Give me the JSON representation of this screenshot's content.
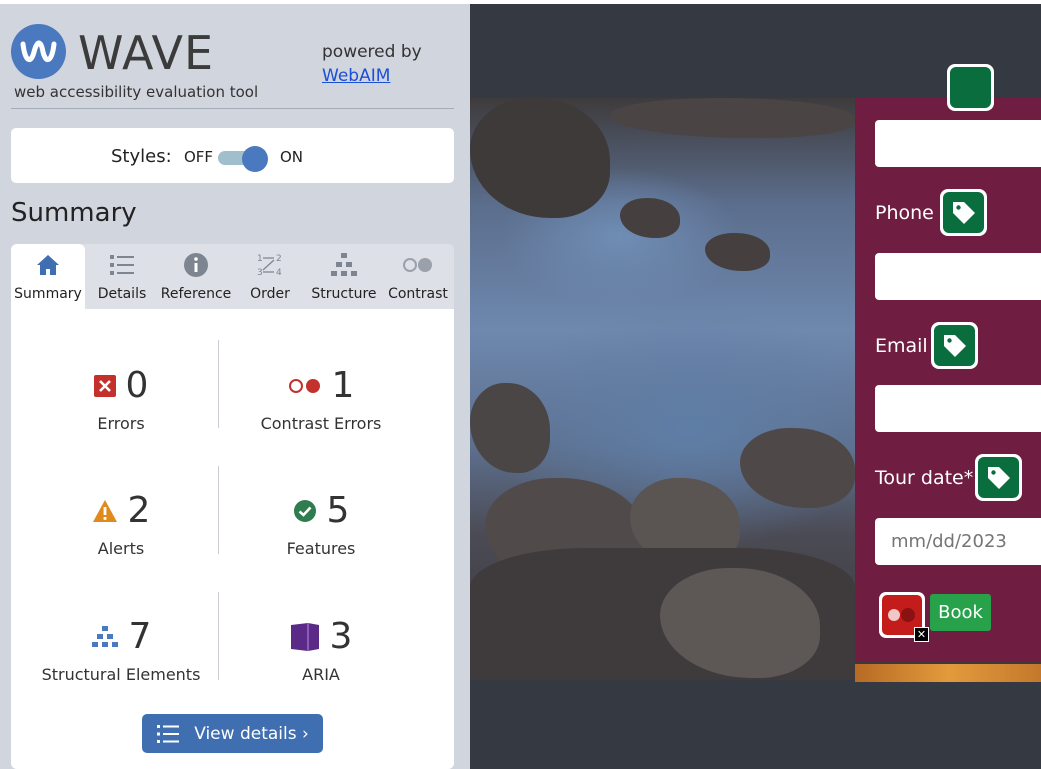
{
  "header": {
    "logo_text": "WAVE",
    "tagline": "web accessibility evaluation tool",
    "powered_by": "powered by",
    "powered_by_link": "WebAIM"
  },
  "styles_toggle": {
    "label": "Styles:",
    "off_label": "OFF",
    "on_label": "ON",
    "state": "ON"
  },
  "summary": {
    "heading": "Summary"
  },
  "tabs": [
    {
      "label": "Summary",
      "icon": "home-icon",
      "active": true
    },
    {
      "label": "Details",
      "icon": "list-icon",
      "active": false
    },
    {
      "label": "Reference",
      "icon": "info-icon",
      "active": false
    },
    {
      "label": "Order",
      "icon": "order-icon",
      "active": false
    },
    {
      "label": "Structure",
      "icon": "structure-icon",
      "active": false
    },
    {
      "label": "Contrast",
      "icon": "contrast-icon",
      "active": false
    }
  ],
  "stats": {
    "errors": {
      "count": "0",
      "label": "Errors",
      "color": "#c4302b"
    },
    "contrast_errors": {
      "count": "1",
      "label": "Contrast Errors",
      "color": "#c4302b"
    },
    "alerts": {
      "count": "2",
      "label": "Alerts",
      "color": "#e08a1e"
    },
    "features": {
      "count": "5",
      "label": "Features",
      "color": "#2f7d4f"
    },
    "structural": {
      "count": "7",
      "label": "Structural Elements",
      "color": "#4a79c0"
    },
    "aria": {
      "count": "3",
      "label": "ARIA",
      "color": "#5b2a86"
    }
  },
  "view_details_button": "View details ›",
  "page_form": {
    "phone_label": "Phone",
    "email_label": "Email",
    "tour_date_label": "Tour date*",
    "tour_date_placeholder": "mm/dd/2023",
    "book_button": "Book",
    "panel_color": "#701d42",
    "book_color": "#27a24a"
  }
}
